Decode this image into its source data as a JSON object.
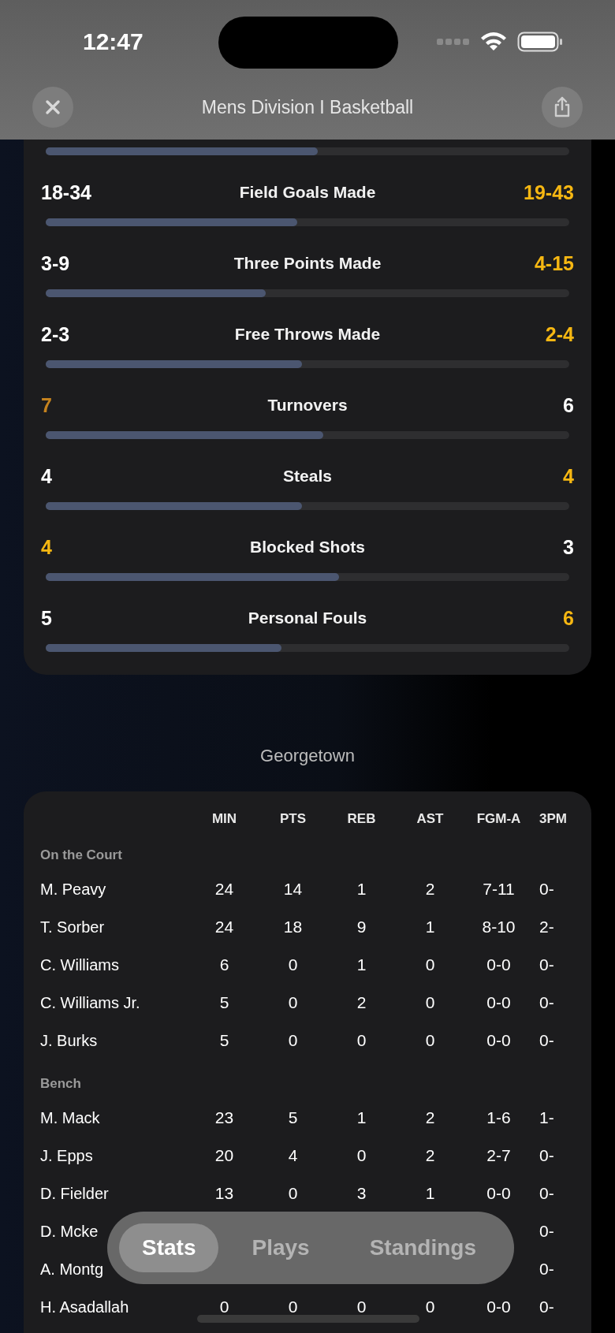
{
  "status_bar": {
    "time": "12:47"
  },
  "header": {
    "title": "Mens Division I Basketball"
  },
  "team_stats": {
    "top_bar": {
      "level": 0.52
    },
    "rows": [
      {
        "label": "Field Goals Made",
        "left": {
          "text": "18-34",
          "color": "#ffffff"
        },
        "right": {
          "text": "19-43",
          "color": "#f6b712"
        },
        "level": 0.48
      },
      {
        "label": "Three Points Made",
        "left": {
          "text": "3-9",
          "color": "#ffffff"
        },
        "right": {
          "text": "4-15",
          "color": "#f6b712"
        },
        "level": 0.42
      },
      {
        "label": "Free Throws Made",
        "left": {
          "text": "2-3",
          "color": "#ffffff"
        },
        "right": {
          "text": "2-4",
          "color": "#f6b712"
        },
        "level": 0.49
      },
      {
        "label": "Turnovers",
        "left": {
          "text": "7",
          "color": "#c4821e"
        },
        "right": {
          "text": "6",
          "color": "#ffffff"
        },
        "level": 0.53
      },
      {
        "label": "Steals",
        "left": {
          "text": "4",
          "color": "#ffffff"
        },
        "right": {
          "text": "4",
          "color": "#f6b712"
        },
        "level": 0.49
      },
      {
        "label": "Blocked Shots",
        "left": {
          "text": "4",
          "color": "#f6b712"
        },
        "right": {
          "text": "3",
          "color": "#ffffff"
        },
        "level": 0.56
      },
      {
        "label": "Personal Fouls",
        "left": {
          "text": "5",
          "color": "#ffffff"
        },
        "right": {
          "text": "6",
          "color": "#f6b712"
        },
        "level": 0.45
      }
    ]
  },
  "team_name": "Georgetown",
  "box_score": {
    "columns": [
      "MIN",
      "PTS",
      "REB",
      "AST",
      "FGM-A",
      "3PM"
    ],
    "groups": [
      {
        "title": "On the Court",
        "rows": [
          {
            "name": "M. Peavy",
            "cells": [
              "24",
              "14",
              "1",
              "2",
              "7-11",
              "0-"
            ]
          },
          {
            "name": "T. Sorber",
            "cells": [
              "24",
              "18",
              "9",
              "1",
              "8-10",
              "2-"
            ]
          },
          {
            "name": "C. Williams",
            "cells": [
              "6",
              "0",
              "1",
              "0",
              "0-0",
              "0-"
            ]
          },
          {
            "name": "C. Williams Jr.",
            "cells": [
              "5",
              "0",
              "2",
              "0",
              "0-0",
              "0-"
            ]
          },
          {
            "name": "J. Burks",
            "cells": [
              "5",
              "0",
              "0",
              "0",
              "0-0",
              "0-"
            ]
          }
        ]
      },
      {
        "title": "Bench",
        "rows": [
          {
            "name": "M. Mack",
            "cells": [
              "23",
              "5",
              "1",
              "2",
              "1-6",
              "1-"
            ]
          },
          {
            "name": "J. Epps",
            "cells": [
              "20",
              "4",
              "0",
              "2",
              "2-7",
              "0-"
            ]
          },
          {
            "name": "D. Fielder",
            "cells": [
              "13",
              "0",
              "3",
              "1",
              "0-0",
              "0-"
            ]
          },
          {
            "name": "D. Mcke",
            "cells": [
              null,
              null,
              null,
              null,
              null,
              "0-"
            ]
          },
          {
            "name": "A. Montg",
            "cells": [
              null,
              null,
              null,
              null,
              null,
              "0-"
            ]
          },
          {
            "name": "H. Asadallah",
            "cells": [
              "0",
              "0",
              "0",
              "0",
              "0-0",
              "0-"
            ]
          }
        ]
      }
    ]
  },
  "tabs": [
    {
      "label": "Stats",
      "selected": true
    },
    {
      "label": "Plays",
      "selected": false
    },
    {
      "label": "Standings",
      "selected": false
    }
  ]
}
